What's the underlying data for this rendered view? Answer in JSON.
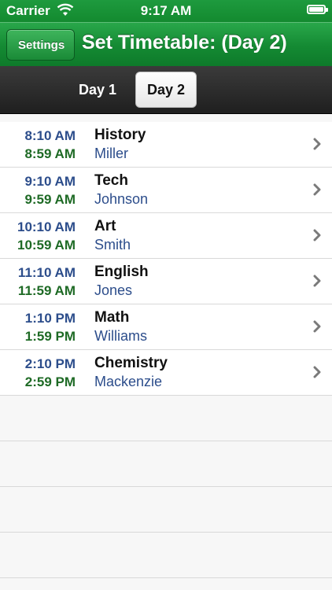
{
  "status_bar": {
    "carrier": "Carrier",
    "time": "9:17 AM"
  },
  "nav": {
    "back_label": "Settings",
    "title": "Set Timetable: (Day 2)"
  },
  "segments": {
    "day1": "Day 1",
    "day2": "Day 2",
    "selected": "Day 2"
  },
  "timetable": [
    {
      "start": "8:10 AM",
      "end": "8:59 AM",
      "subject": "History",
      "teacher": "Miller"
    },
    {
      "start": "9:10 AM",
      "end": "9:59 AM",
      "subject": "Tech",
      "teacher": "Johnson"
    },
    {
      "start": "10:10 AM",
      "end": "10:59 AM",
      "subject": "Art",
      "teacher": "Smith"
    },
    {
      "start": "11:10 AM",
      "end": "11:59 AM",
      "subject": "English",
      "teacher": "Jones"
    },
    {
      "start": "1:10 PM",
      "end": "1:59 PM",
      "subject": "Math",
      "teacher": "Williams"
    },
    {
      "start": "2:10 PM",
      "end": "2:59 PM",
      "subject": "Chemistry",
      "teacher": "Mackenzie"
    }
  ],
  "colors": {
    "accent_green": "#148a33",
    "start_time_blue": "#2c4d8b",
    "end_time_green": "#1e6a25"
  }
}
